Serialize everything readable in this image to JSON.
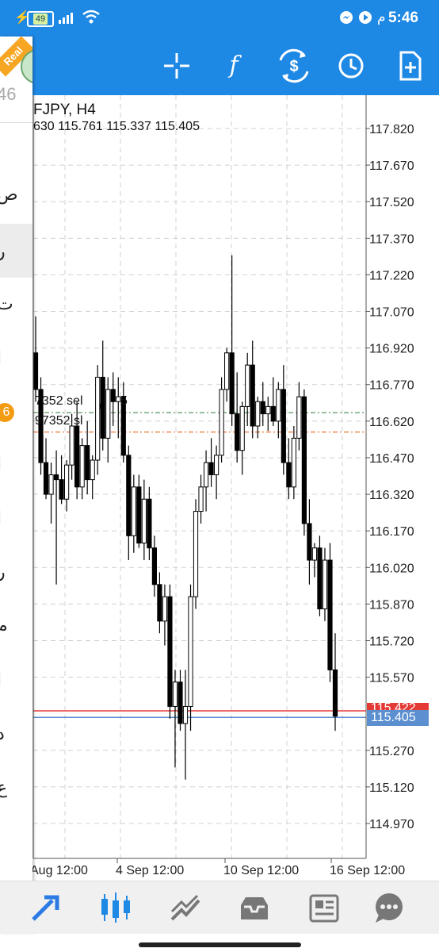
{
  "status": {
    "time": "5:46",
    "battery": "49",
    "rtl_label": "م"
  },
  "toolbar": {
    "badge": "Real",
    "buttons": [
      {
        "name": "crosshair-icon"
      },
      {
        "name": "indicators-icon",
        "glyph": "f"
      },
      {
        "name": "trade-icon"
      },
      {
        "name": "timeframe-clock-icon"
      },
      {
        "name": "add-objects-icon"
      }
    ]
  },
  "panel": {
    "number": "46",
    "badge": "6",
    "items": [
      "ص",
      "ر",
      "ت",
      "ا",
      "",
      "ا",
      "ا",
      "ر",
      "م",
      "ا",
      "د",
      "ع"
    ]
  },
  "chart": {
    "symbol_label": "FJPY, H4",
    "ohlc_label": "630 115.761 115.337 115.405",
    "order_sell_label": "7352 sel",
    "order_sell_tail": "5",
    "order_sell2_label": "97352 sl",
    "bid_price": "115.405",
    "ask_price": "115.422",
    "colors": {
      "bull_body": "#ffffff",
      "bear_body": "#000000",
      "bid_line": "#5b8fd0",
      "ask_line": "#e53935",
      "order_line": "#2e7d32",
      "sl_line": "#e65100"
    }
  },
  "chart_data": {
    "type": "candlestick",
    "symbol": "FJPY",
    "timeframe": "H4",
    "y_ticks": [
      "117.820",
      "117.670",
      "117.520",
      "117.370",
      "117.220",
      "117.070",
      "116.920",
      "116.770",
      "116.620",
      "116.470",
      "116.320",
      "116.170",
      "116.020",
      "115.870",
      "115.720",
      "115.570",
      "115.270",
      "115.120",
      "114.970"
    ],
    "x_ticks": [
      "Aug 12:00",
      "4 Sep 12:00",
      "10 Sep 12:00",
      "16 Sep 12:00"
    ],
    "ylim": [
      114.94,
      117.92
    ],
    "grid": true,
    "levels": {
      "bid": 115.405,
      "ask": 115.432,
      "order": 116.655,
      "stop_loss": 116.575
    },
    "candles": [
      [
        116.9,
        117.05,
        116.7,
        116.75
      ],
      [
        116.75,
        116.8,
        116.4,
        116.45
      ],
      [
        116.45,
        116.55,
        116.3,
        116.32
      ],
      [
        116.32,
        116.45,
        116.2,
        116.4
      ],
      [
        116.4,
        116.5,
        115.95,
        116.38
      ],
      [
        116.38,
        116.48,
        116.28,
        116.3
      ],
      [
        116.3,
        116.46,
        116.25,
        116.44
      ],
      [
        116.44,
        116.65,
        116.38,
        116.6
      ],
      [
        116.6,
        116.7,
        116.3,
        116.35
      ],
      [
        116.35,
        116.55,
        116.3,
        116.52
      ],
      [
        116.52,
        116.62,
        116.32,
        116.38
      ],
      [
        116.38,
        116.48,
        116.3,
        116.46
      ],
      [
        116.46,
        116.85,
        116.4,
        116.8
      ],
      [
        116.8,
        116.95,
        116.5,
        116.55
      ],
      [
        116.55,
        116.8,
        116.45,
        116.75
      ],
      [
        116.75,
        116.82,
        116.6,
        116.7
      ],
      [
        116.7,
        116.8,
        116.55,
        116.72
      ],
      [
        116.72,
        116.78,
        116.45,
        116.48
      ],
      [
        116.48,
        116.52,
        116.05,
        116.15
      ],
      [
        116.15,
        116.4,
        116.08,
        116.35
      ],
      [
        116.35,
        116.4,
        116.1,
        116.12
      ],
      [
        116.12,
        116.38,
        116.05,
        116.3
      ],
      [
        116.3,
        116.35,
        116.05,
        116.1
      ],
      [
        116.1,
        116.15,
        115.9,
        115.95
      ],
      [
        115.95,
        116.0,
        115.75,
        115.8
      ],
      [
        115.8,
        115.95,
        115.7,
        115.9
      ],
      [
        115.9,
        115.95,
        115.4,
        115.45
      ],
      [
        115.45,
        115.6,
        115.2,
        115.55
      ],
      [
        115.55,
        115.6,
        115.35,
        115.38
      ],
      [
        115.38,
        115.6,
        115.15,
        115.45
      ],
      [
        115.45,
        115.95,
        115.35,
        115.9
      ],
      [
        115.9,
        116.3,
        115.85,
        116.25
      ],
      [
        116.25,
        116.4,
        116.2,
        116.35
      ],
      [
        116.35,
        116.5,
        116.25,
        116.45
      ],
      [
        116.45,
        116.55,
        116.35,
        116.4
      ],
      [
        116.4,
        116.52,
        116.3,
        116.48
      ],
      [
        116.48,
        116.8,
        116.45,
        116.75
      ],
      [
        116.75,
        116.92,
        116.7,
        116.9
      ],
      [
        116.9,
        117.3,
        116.6,
        116.65
      ],
      [
        116.65,
        116.82,
        116.45,
        116.5
      ],
      [
        116.5,
        116.7,
        116.4,
        116.68
      ],
      [
        116.68,
        116.9,
        116.6,
        116.85
      ],
      [
        116.85,
        116.95,
        116.55,
        116.6
      ],
      [
        116.6,
        116.72,
        116.55,
        116.7
      ],
      [
        116.7,
        116.78,
        116.6,
        116.65
      ],
      [
        116.65,
        116.72,
        116.58,
        116.68
      ],
      [
        116.68,
        116.8,
        116.6,
        116.62
      ],
      [
        116.62,
        116.78,
        116.55,
        116.75
      ],
      [
        116.75,
        116.85,
        116.4,
        116.45
      ],
      [
        116.45,
        116.55,
        116.3,
        116.35
      ],
      [
        116.35,
        116.6,
        116.3,
        116.55
      ],
      [
        116.55,
        116.78,
        116.5,
        116.72
      ],
      [
        116.72,
        116.75,
        116.15,
        116.2
      ],
      [
        116.2,
        116.3,
        115.95,
        116.05
      ],
      [
        116.05,
        116.12,
        115.98,
        116.1
      ],
      [
        116.1,
        116.15,
        115.82,
        115.85
      ],
      [
        115.85,
        116.1,
        115.8,
        116.05
      ],
      [
        116.05,
        116.12,
        115.55,
        115.6
      ],
      [
        115.6,
        115.75,
        115.35,
        115.41
      ]
    ]
  },
  "bottom_nav": [
    {
      "name": "quotes-nav-icon"
    },
    {
      "name": "chart-nav-icon",
      "active": true
    },
    {
      "name": "trade-nav-icon"
    },
    {
      "name": "history-nav-icon"
    },
    {
      "name": "news-nav-icon"
    },
    {
      "name": "chat-nav-icon"
    }
  ]
}
